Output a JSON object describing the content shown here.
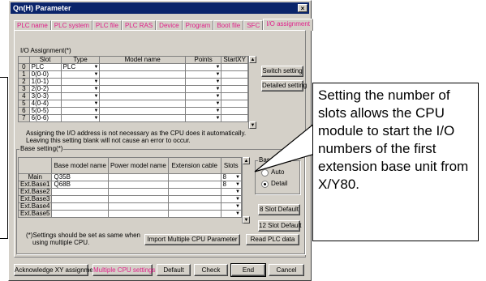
{
  "window": {
    "title": "Qn(H) Parameter",
    "close_glyph": "×"
  },
  "tabs": [
    {
      "label": "PLC name"
    },
    {
      "label": "PLC system"
    },
    {
      "label": "PLC file"
    },
    {
      "label": "PLC RAS"
    },
    {
      "label": "Device"
    },
    {
      "label": "Program"
    },
    {
      "label": "Boot file"
    },
    {
      "label": "SFC"
    },
    {
      "label": "I/O assignment"
    }
  ],
  "io_assignment": {
    "title": "I/O Assignment(*)",
    "headers": [
      "",
      "Slot",
      "Type",
      "Model name",
      "Points",
      "StartXY"
    ],
    "rows": [
      {
        "no": "0",
        "slot": "PLC",
        "type": "PLC"
      },
      {
        "no": "1",
        "slot": "0(0-0)",
        "type": ""
      },
      {
        "no": "2",
        "slot": "1(0-1)",
        "type": ""
      },
      {
        "no": "3",
        "slot": "2(0-2)",
        "type": ""
      },
      {
        "no": "4",
        "slot": "3(0-3)",
        "type": ""
      },
      {
        "no": "5",
        "slot": "4(0-4)",
        "type": ""
      },
      {
        "no": "6",
        "slot": "5(0-5)",
        "type": ""
      },
      {
        "no": "7",
        "slot": "6(0-6)",
        "type": ""
      }
    ],
    "switch_setting": "Switch setting",
    "detailed_setting": "Detailed setting",
    "note_line1": "Assigning the I/O address is not necessary as the CPU does it automatically.",
    "note_line2": "Leaving this setting blank will not cause an error to occur."
  },
  "base_setting": {
    "title": "Base setting(*)",
    "headers": [
      "",
      "Base model name",
      "Power model name",
      "Extension cable",
      "Slots"
    ],
    "rows": [
      {
        "name": "Main",
        "base": "Q35B",
        "slots": "8"
      },
      {
        "name": "Ext.Base1",
        "base": "Q68B",
        "slots": "8"
      },
      {
        "name": "Ext.Base2",
        "base": "",
        "slots": ""
      },
      {
        "name": "Ext.Base3",
        "base": "",
        "slots": ""
      },
      {
        "name": "Ext.Base4",
        "base": "",
        "slots": ""
      },
      {
        "name": "Ext.Base5",
        "base": "",
        "slots": ""
      }
    ],
    "base_mode": {
      "title": "Base mode",
      "auto": "Auto",
      "detail": "Detail",
      "selected": "detail"
    },
    "slot8_default": "8 Slot Default",
    "slot12_default": "12 Slot Default",
    "multi_cpu_note_1": "(*)Settings should be set as same when",
    "multi_cpu_note_2": "using multiple CPU.",
    "import_multi_cpu": "Import Multiple CPU Parameter",
    "read_plc_data": "Read PLC data"
  },
  "footer": {
    "acknowledge": "Acknowledge XY assignment",
    "multiple_cpu": "Multiple CPU settings",
    "default": "Default",
    "check": "Check",
    "end": "End",
    "cancel": "Cancel"
  },
  "callout": {
    "text": "Setting the number of slots allows the CPU module to start the I/O numbers of the first extension base unit from X/Y80."
  },
  "colors": {
    "title_bar": "#0a246a",
    "dialog_face": "#d4d0c8",
    "tab_text": "#e0208a"
  }
}
